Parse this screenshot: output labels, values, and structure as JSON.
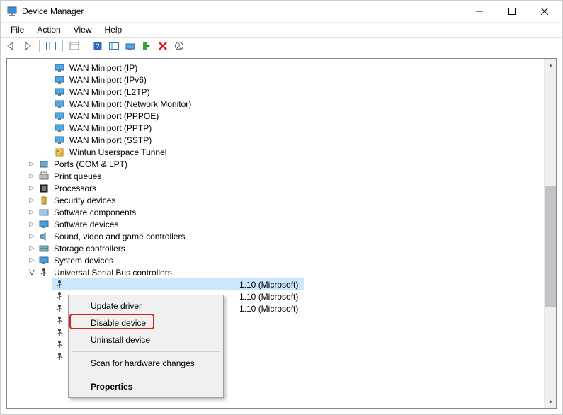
{
  "window": {
    "title": "Device Manager"
  },
  "menu": {
    "items": [
      "File",
      "Action",
      "View",
      "Help"
    ]
  },
  "tree": {
    "miniports": [
      "WAN Miniport (IP)",
      "WAN Miniport (IPv6)",
      "WAN Miniport (L2TP)",
      "WAN Miniport (Network Monitor)",
      "WAN Miniport (PPPOE)",
      "WAN Miniport (PPTP)",
      "WAN Miniport (SSTP)",
      "Wintun Userspace Tunnel"
    ],
    "categories": [
      "Ports (COM & LPT)",
      "Print queues",
      "Processors",
      "Security devices",
      "Software components",
      "Software devices",
      "Sound, video and game controllers",
      "Storage controllers",
      "System devices",
      "Universal Serial Bus controllers"
    ],
    "usb_tail": "1.10 (Microsoft)"
  },
  "context_menu": {
    "update": "Update driver",
    "disable": "Disable device",
    "uninstall": "Uninstall device",
    "scan": "Scan for hardware changes",
    "properties": "Properties"
  }
}
